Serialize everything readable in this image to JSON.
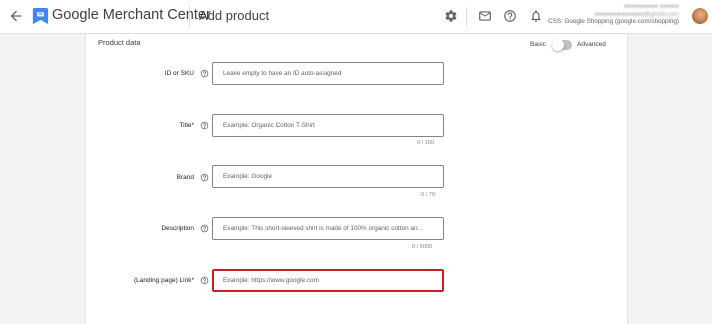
{
  "header": {
    "app_name": "Google Merchant Center",
    "page_title": "Add product",
    "account": {
      "line1": "●●●●●●●●● ●●●●●",
      "line2": "●●●●●●●●●●●●●@gmail.com",
      "css_label": "CSS: Google Shopping (google.com/shopping)"
    },
    "icons": [
      "back-arrow-icon",
      "merchant-center-logo",
      "gear-icon",
      "mail-icon",
      "help-icon",
      "bell-icon",
      "avatar"
    ]
  },
  "section": {
    "title": "Product data",
    "toggle": {
      "left_label": "Basic",
      "right_label": "Advanced",
      "state": "basic"
    }
  },
  "fields": [
    {
      "label": "ID or SKU",
      "placeholder": "Leave empty to have an ID auto-assigned",
      "counter": ""
    },
    {
      "label": "Title*",
      "placeholder": "Example: Organic Cotton T-Shirt",
      "counter": "0 / 150"
    },
    {
      "label": "Brand",
      "placeholder": "Example: Google",
      "counter": "0 / 70"
    },
    {
      "label": "Description",
      "placeholder": "Example: This short-sleeved shirt is made of 100% organic cotton an...",
      "counter": "0 / 5000"
    },
    {
      "label": "(Landing page) Link*",
      "placeholder": "Example: https://www.google.com",
      "counter": "",
      "state": "error"
    }
  ],
  "colors": {
    "error_border": "#c5221f",
    "logo_blue": "#4285f4"
  }
}
